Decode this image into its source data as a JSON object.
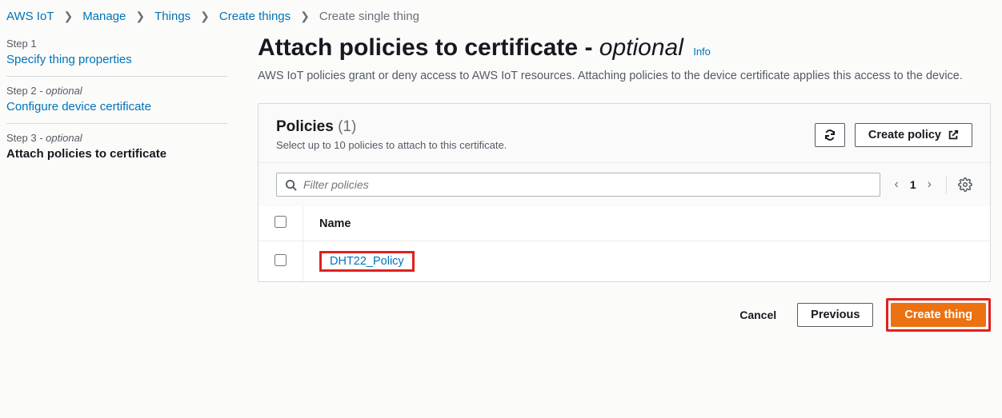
{
  "breadcrumb": [
    {
      "label": "AWS IoT",
      "link": true
    },
    {
      "label": "Manage",
      "link": true
    },
    {
      "label": "Things",
      "link": true
    },
    {
      "label": "Create things",
      "link": true
    },
    {
      "label": "Create single thing",
      "link": false
    }
  ],
  "sidebar": {
    "steps": [
      {
        "label": "Step 1",
        "optional": false,
        "title": "Specify thing properties",
        "current": false
      },
      {
        "label": "Step 2",
        "optional": true,
        "title": "Configure device certificate",
        "current": false
      },
      {
        "label": "Step 3",
        "optional": true,
        "title": "Attach policies to certificate",
        "current": true
      }
    ],
    "optional_text": "- optional"
  },
  "main": {
    "title": "Attach policies to certificate -",
    "title_optional": "optional",
    "info": "Info",
    "description": "AWS IoT policies grant or deny access to AWS IoT resources. Attaching policies to the device certificate applies this access to the device."
  },
  "panel": {
    "title": "Policies",
    "count": "(1)",
    "subtitle": "Select up to 10 policies to attach to this certificate.",
    "refresh_title": "Refresh",
    "create_policy": "Create policy",
    "filter_placeholder": "Filter policies",
    "page_number": "1",
    "settings_title": "Settings",
    "table": {
      "header_name": "Name",
      "rows": [
        {
          "name": "DHT22_Policy"
        }
      ]
    }
  },
  "footer": {
    "cancel": "Cancel",
    "previous": "Previous",
    "create": "Create thing"
  }
}
